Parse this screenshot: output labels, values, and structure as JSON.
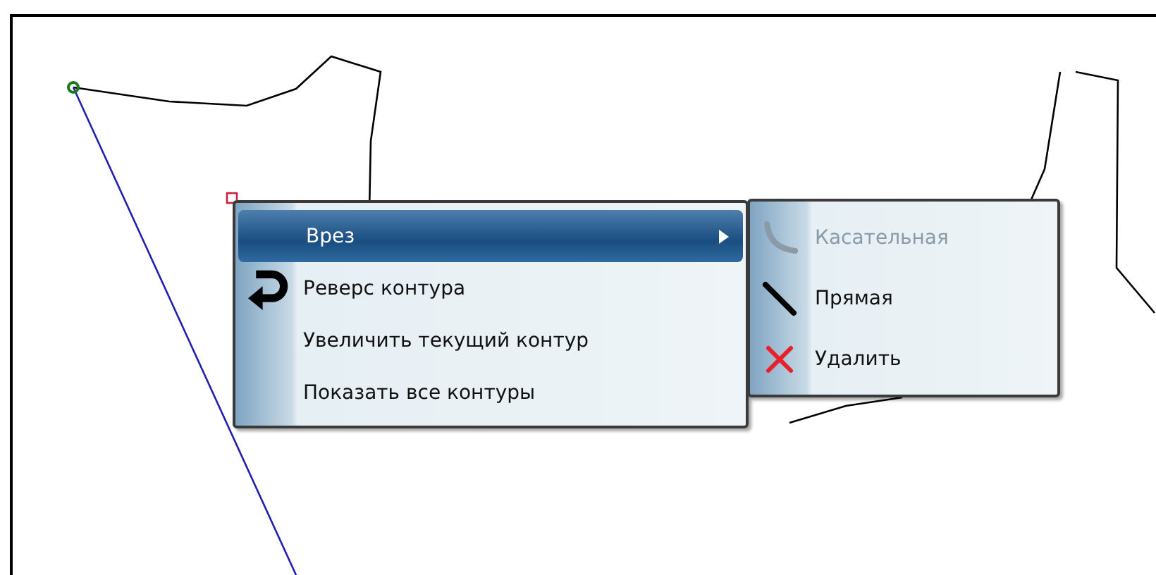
{
  "context_menu": {
    "items": [
      {
        "label": "Врез",
        "selected": true,
        "has_submenu": true
      },
      {
        "label": "Реверс контура",
        "selected": false,
        "has_submenu": false
      },
      {
        "label": "Увеличить текущий контур",
        "selected": false,
        "has_submenu": false
      },
      {
        "label": "Показать все контуры",
        "selected": false,
        "has_submenu": false
      }
    ]
  },
  "submenu": {
    "items": [
      {
        "label": "Касательная",
        "disabled": true
      },
      {
        "label": "Прямая",
        "disabled": false
      },
      {
        "label": "Удалить",
        "disabled": false
      }
    ]
  }
}
